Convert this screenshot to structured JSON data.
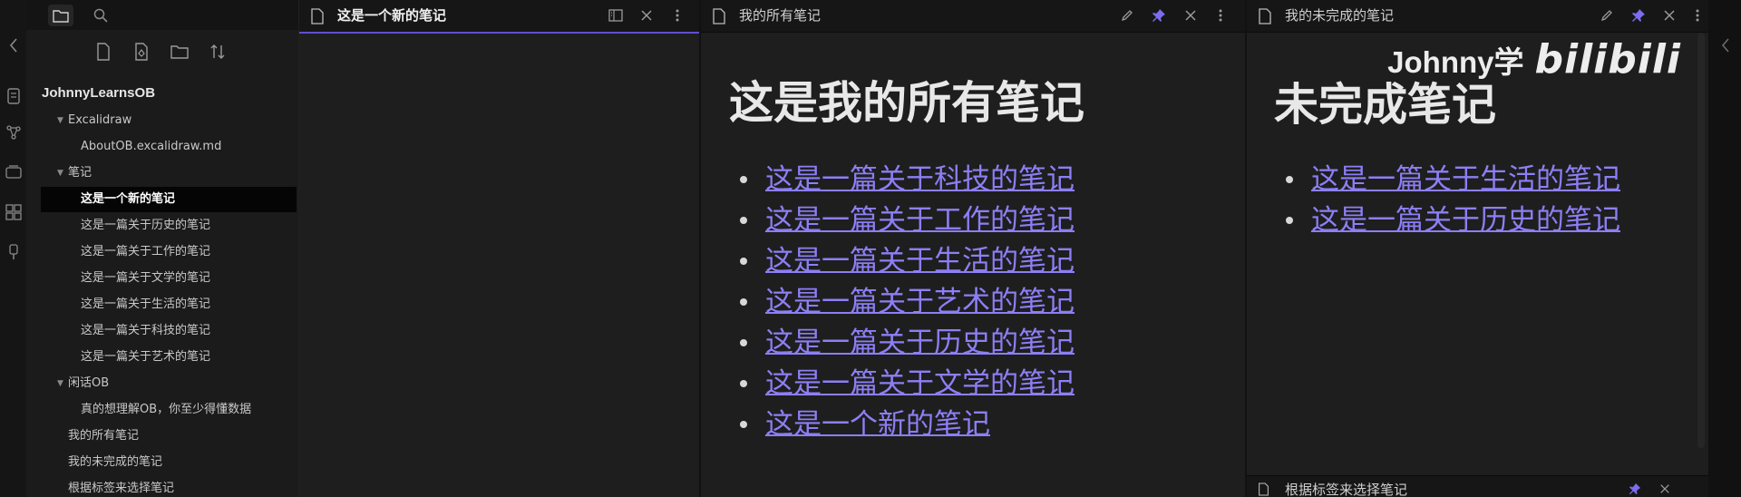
{
  "colors": {
    "accent": "#5f4fd1",
    "link": "#8c7ff5",
    "background": "#1e1e1e",
    "sidebar": "#1b1b1b"
  },
  "sidebar": {
    "vault_name": "JohnnyLearnsOB",
    "tree": [
      {
        "label": "Excalidraw",
        "kind": "folder",
        "expanded": true
      },
      {
        "label": "AboutOB.excalidraw.md",
        "kind": "file"
      },
      {
        "label": "笔记",
        "kind": "folder",
        "expanded": true
      },
      {
        "label": "这是一个新的笔记",
        "kind": "file",
        "active": true
      },
      {
        "label": "这是一篇关于历史的笔记",
        "kind": "file"
      },
      {
        "label": "这是一篇关于工作的笔记",
        "kind": "file"
      },
      {
        "label": "这是一篇关于文学的笔记",
        "kind": "file"
      },
      {
        "label": "这是一篇关于生活的笔记",
        "kind": "file"
      },
      {
        "label": "这是一篇关于科技的笔记",
        "kind": "file"
      },
      {
        "label": "这是一篇关于艺术的笔记",
        "kind": "file"
      },
      {
        "label": "闲话OB",
        "kind": "folder",
        "expanded": true
      },
      {
        "label": "真的想理解OB，你至少得懂数据",
        "kind": "file"
      },
      {
        "label": "我的所有笔记",
        "kind": "file"
      },
      {
        "label": "我的未完成的笔记",
        "kind": "file"
      },
      {
        "label": "根据标签来选择笔记",
        "kind": "file"
      }
    ]
  },
  "panes": {
    "left": {
      "title": "这是一个新的笔记"
    },
    "middle": {
      "title": "我的所有笔记",
      "heading": "这是我的所有笔记",
      "links": [
        "这是一篇关于科技的笔记",
        "这是一篇关于工作的笔记",
        "这是一篇关于生活的笔记",
        "这是一篇关于艺术的笔记",
        "这是一篇关于历史的笔记",
        "这是一篇关于文学的笔记",
        "这是一个新的笔记"
      ]
    },
    "right": {
      "title": "我的未完成的笔记",
      "heading": "未完成笔记",
      "links": [
        "这是一篇关于生活的笔记",
        "这是一篇关于历史的笔记"
      ],
      "bottom_title": "根据标签来选择笔记"
    }
  },
  "watermark": {
    "text": "Johnny学",
    "logo": "bilibili"
  }
}
